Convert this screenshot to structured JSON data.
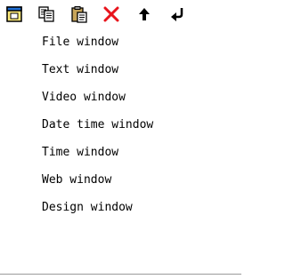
{
  "toolbar": {
    "buttons": [
      {
        "id": "new",
        "icon": "new-window-icon"
      },
      {
        "id": "copy",
        "icon": "copy-icon"
      },
      {
        "id": "paste",
        "icon": "paste-icon"
      },
      {
        "id": "delete",
        "icon": "delete-icon"
      },
      {
        "id": "move_up",
        "icon": "arrow-up-icon"
      },
      {
        "id": "back",
        "icon": "arrow-return-icon"
      }
    ],
    "colors": {
      "delete": "#e8141c",
      "new_icon_fill": "#ffeb7a",
      "new_icon_header": "#1f6fd6",
      "arrows": "#000000"
    }
  },
  "menu": {
    "items": [
      {
        "label": "File window"
      },
      {
        "label": "Text window"
      },
      {
        "label": "Video window"
      },
      {
        "label": "Date time window"
      },
      {
        "label": "Time window"
      },
      {
        "label": "Web window"
      },
      {
        "label": "Design window"
      }
    ]
  }
}
